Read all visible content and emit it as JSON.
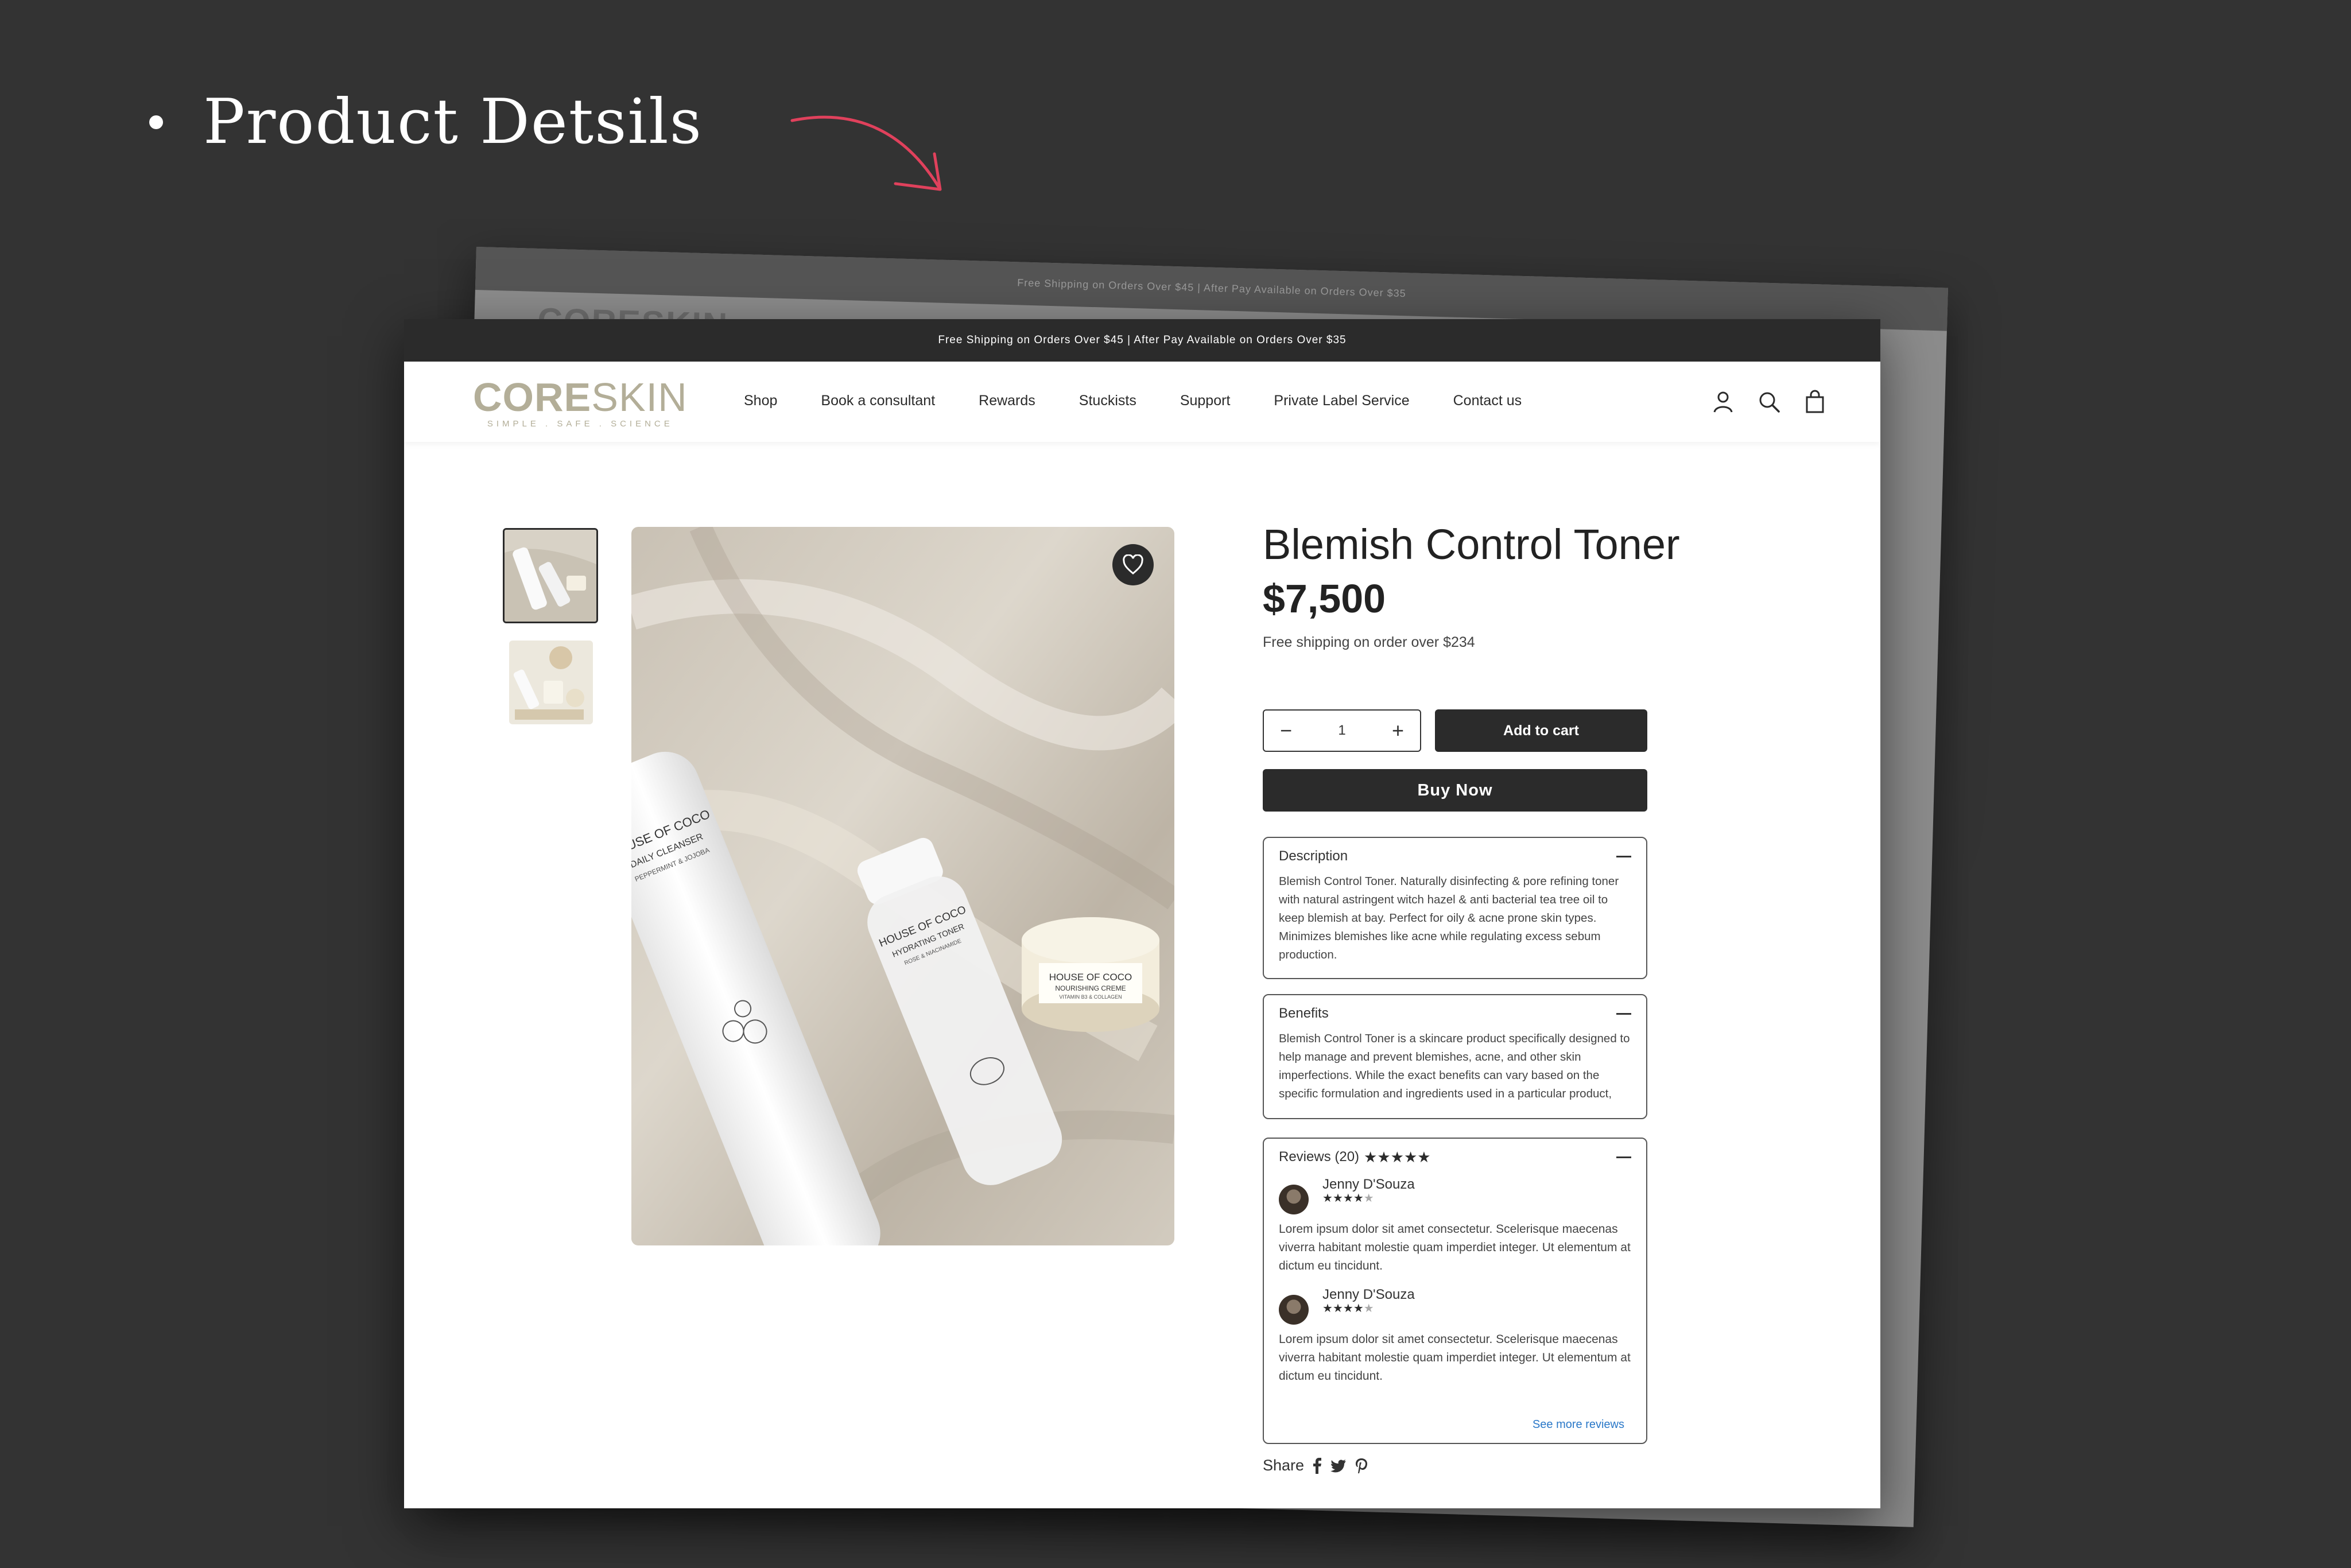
{
  "heading": {
    "text": "Product Detsils"
  },
  "background_sheet": {
    "topbar_text": "Free Shipping on Orders Over $45 | After Pay Available on Orders Over $35",
    "logo_text": "CORESKIN"
  },
  "topbar": {
    "text": "Free Shipping on Orders Over $45 | After Pay Available on Orders Over $35"
  },
  "logo": {
    "core": "CORE",
    "skin": "SKIN",
    "tagline": "SIMPLE . SAFE . SCIENCE"
  },
  "nav": {
    "items": [
      {
        "label": "Shop"
      },
      {
        "label": "Book a consultant"
      },
      {
        "label": "Rewards"
      },
      {
        "label": "Stuckists"
      },
      {
        "label": "Support"
      },
      {
        "label": "Private Label Service"
      },
      {
        "label": "Contact us"
      }
    ],
    "icons": [
      "account-icon",
      "search-icon",
      "cart-icon"
    ]
  },
  "product": {
    "title": "Blemish Control Toner",
    "price": "$7,500",
    "shipping_note": "Free shipping on order over $234",
    "quantity": "1",
    "add_to_cart": "Add to cart",
    "buy_now": "Buy Now",
    "image_labels": {
      "bottle1_brand": "HOUSE OF COCO",
      "bottle1_name": "DAILY CLEANSER",
      "bottle1_sub": "PEPPERMINT & JOJOBA",
      "bottle2_brand": "HOUSE OF COCO",
      "bottle2_name": "HYDRATING TONER",
      "bottle2_sub": "ROSE & NIACINAMIDE",
      "jar_brand": "HOUSE OF COCO",
      "jar_name": "NOURISHING CREME",
      "jar_sub": "VITAMIN B3 & COLLAGEN"
    }
  },
  "description": {
    "title": "Description",
    "body": "Blemish Control Toner. Naturally disinfecting & pore refining toner with natural astringent witch hazel & anti bacterial tea tree oil to keep blemish at bay. Perfect for oily & acne prone skin types. Minimizes blemishes like acne while regulating excess sebum production."
  },
  "benefits": {
    "title": "Benefits",
    "body": "Blemish Control Toner is a skincare product specifically designed to help manage and prevent blemishes, acne, and other skin imperfections. While the exact benefits can vary based on the specific formulation and ingredients used in a particular product,"
  },
  "reviews": {
    "title": "Reviews (20)",
    "overall_rating": 5,
    "items": [
      {
        "name": "Jenny D'Souza",
        "rating": 4,
        "text": "Lorem ipsum dolor sit amet consectetur. Scelerisque maecenas viverra habitant molestie quam imperdiet integer. Ut elementum at dictum eu tincidunt."
      },
      {
        "name": "Jenny D'Souza",
        "rating": 4,
        "text": "Lorem ipsum dolor sit amet consectetur. Scelerisque maecenas viverra habitant molestie quam imperdiet integer. Ut elementum at dictum eu tincidunt."
      }
    ],
    "see_more": "See more reviews"
  },
  "share": {
    "label": "Share",
    "icons": [
      "facebook-icon",
      "twitter-icon",
      "pinterest-icon"
    ]
  },
  "colors": {
    "background": "#333333",
    "dark": "#2b2b2b",
    "logo": "#b3ae98",
    "arrow": "#e0415c",
    "link": "#2a78c8"
  }
}
